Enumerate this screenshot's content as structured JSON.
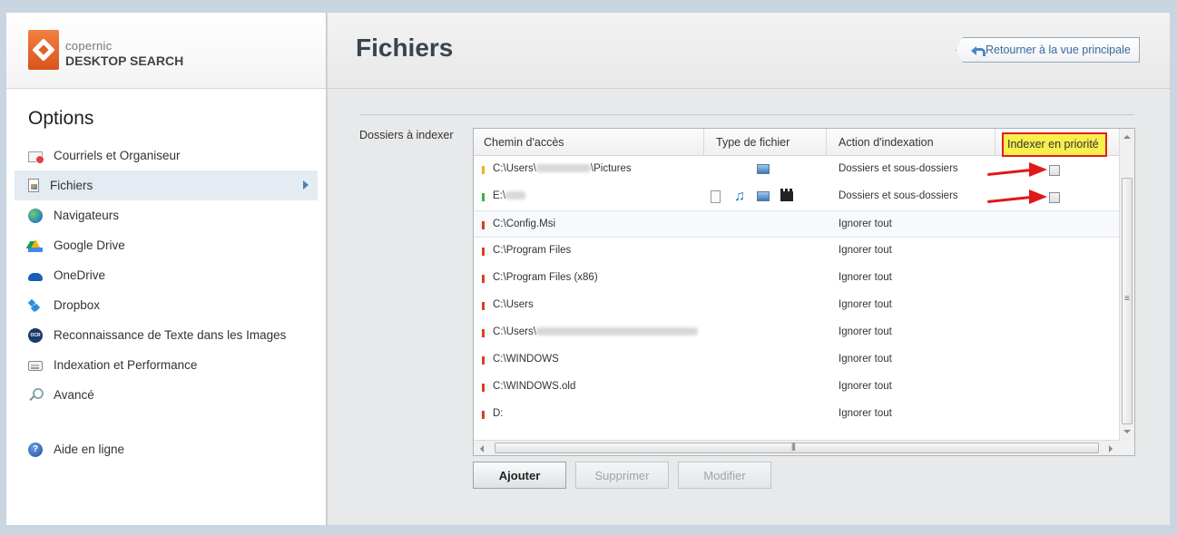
{
  "brand": {
    "small": "copernic",
    "big": "DESKTOP SEARCH"
  },
  "sidebar": {
    "title": "Options",
    "items": [
      {
        "label": "Courriels et Organiseur",
        "icon": "mail-icon"
      },
      {
        "label": "Fichiers",
        "icon": "file-icon",
        "active": true
      },
      {
        "label": "Navigateurs",
        "icon": "globe-icon"
      },
      {
        "label": "Google Drive",
        "icon": "google-drive-icon"
      },
      {
        "label": "OneDrive",
        "icon": "onedrive-icon"
      },
      {
        "label": "Dropbox",
        "icon": "dropbox-icon"
      },
      {
        "label": "Reconnaissance de Texte dans les Images",
        "icon": "ocr-icon"
      },
      {
        "label": "Indexation et Performance",
        "icon": "performance-icon"
      },
      {
        "label": "Avancé",
        "icon": "search-icon"
      }
    ],
    "help": {
      "label": "Aide en ligne",
      "icon": "help-icon"
    }
  },
  "header": {
    "title": "Fichiers",
    "back_label": "Retourner à la vue principale"
  },
  "folders": {
    "label": "Dossiers à indexer",
    "columns": {
      "path": "Chemin d'accès",
      "type": "Type de fichier",
      "action": "Action d'indexation",
      "priority": "Indexer en priorité"
    },
    "rows": [
      {
        "path_prefix": "C:\\Users\\",
        "path_suffix": "\\Pictures",
        "color": "#f0b020",
        "types": [
          "image"
        ],
        "action": "Dossiers et sous-dossiers",
        "priority_checked": false
      },
      {
        "path_prefix": "E:\\",
        "path_suffix": "",
        "color": "#3ab04a",
        "types": [
          "document",
          "music",
          "image",
          "video"
        ],
        "action": "Dossiers et sous-dossiers",
        "priority_checked": false
      },
      {
        "path_prefix": "C:\\Config.Msi",
        "path_suffix": "",
        "color": "#d84020",
        "types": [],
        "action": "Ignorer tout",
        "selected": true
      },
      {
        "path_prefix": "C:\\Program Files",
        "path_suffix": "",
        "color": "#d84020",
        "types": [],
        "action": "Ignorer tout"
      },
      {
        "path_prefix": "C:\\Program Files (x86)",
        "path_suffix": "",
        "color": "#d84020",
        "types": [],
        "action": "Ignorer tout"
      },
      {
        "path_prefix": "C:\\Users",
        "path_suffix": "",
        "color": "#d84020",
        "types": [],
        "action": "Ignorer tout"
      },
      {
        "path_prefix": "C:\\Users\\",
        "path_suffix": "",
        "color": "#d84020",
        "types": [],
        "action": "Ignorer tout"
      },
      {
        "path_prefix": "C:\\WINDOWS",
        "path_suffix": "",
        "color": "#d84020",
        "types": [],
        "action": "Ignorer tout"
      },
      {
        "path_prefix": "C:\\WINDOWS.old",
        "path_suffix": "",
        "color": "#d84020",
        "types": [],
        "action": "Ignorer tout"
      },
      {
        "path_prefix": "D:",
        "path_suffix": "",
        "color": "#d84020",
        "types": [],
        "action": "Ignorer tout"
      }
    ]
  },
  "buttons": {
    "add": "Ajouter",
    "delete": "Supprimer",
    "modify": "Modifier"
  },
  "colors": {
    "accent": "#3a6a9a",
    "priority_highlight": "#f6ef4c",
    "annotation_red": "#e01818"
  }
}
